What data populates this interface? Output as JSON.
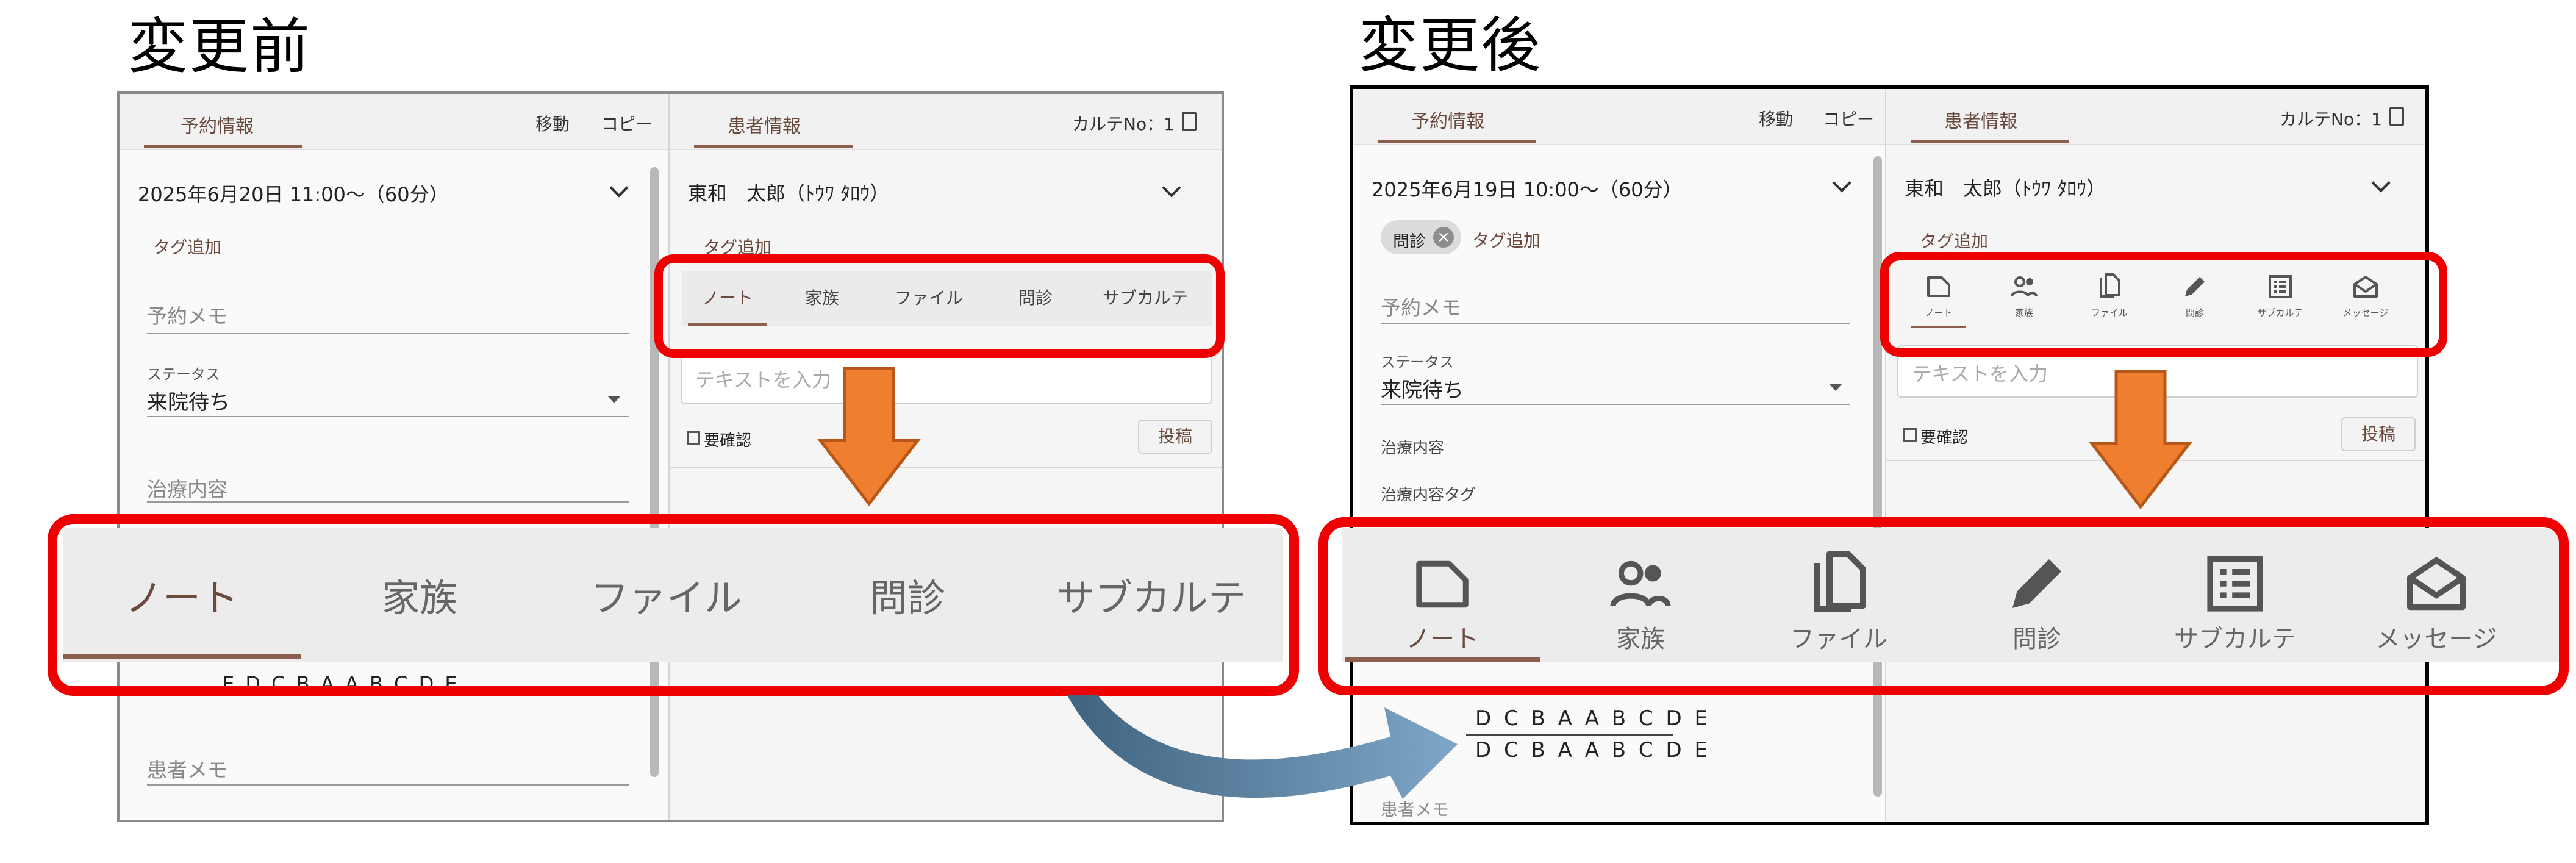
{
  "headings": {
    "before": "変更前",
    "after": "変更後"
  },
  "before": {
    "left_tab": "予約情報",
    "move": "移動",
    "copy": "コピー",
    "right_tab": "患者情報",
    "karte_no": "カルテNo：1",
    "appointment": "2025年6月20日 11:00〜（60分）",
    "tag_add_left": "タグ追加",
    "memo_placeholder": "予約メモ",
    "status_label": "ステータス",
    "status_value": "来院待ち",
    "treatment": "治療内容",
    "dental_chart": "E D C B A A B C D E",
    "patient_memo": "患者メモ",
    "patient_name": "東和　太郎（ﾄｳﾜ ﾀﾛｳ）",
    "tag_add_right": "タグ追加",
    "tabs": [
      "ノート",
      "家族",
      "ファイル",
      "問診",
      "サブカルテ"
    ],
    "text_placeholder": "テキストを入力",
    "need_confirm": "要確認",
    "post": "投稿"
  },
  "after": {
    "left_tab": "予約情報",
    "move": "移動",
    "copy": "コピー",
    "right_tab": "患者情報",
    "karte_no": "カルテNo：1",
    "appointment": "2025年6月19日 10:00〜（60分）",
    "chip_label": "問診",
    "tag_add_left": "タグ追加",
    "memo_placeholder": "予約メモ",
    "status_label": "ステータス",
    "status_value": "来院待ち",
    "treatment": "治療内容",
    "treatment_tag": "治療内容タグ",
    "dental_row1": "D C B A A B C D E",
    "dental_row2": "D C B A A B C D E",
    "patient_memo_partial": "患者メモ",
    "patient_name": "東和　太郎（ﾄｳﾜ ﾀﾛｳ）",
    "tag_add_right": "タグ追加",
    "tabs": [
      "ノート",
      "家族",
      "ファイル",
      "問診",
      "サブカルテ",
      "メッセージ"
    ],
    "text_placeholder": "テキストを入力",
    "need_confirm": "要確認",
    "post": "投稿"
  },
  "icons": [
    "note-icon",
    "family-icon",
    "file-icon",
    "pencil-icon",
    "list-icon",
    "message-icon"
  ],
  "colors": {
    "highlight": "#ee0000",
    "arrow_orange": "#ef7f2f",
    "accent_brown": "#8b5e4d",
    "arrow_blue": "#5a86a8"
  }
}
